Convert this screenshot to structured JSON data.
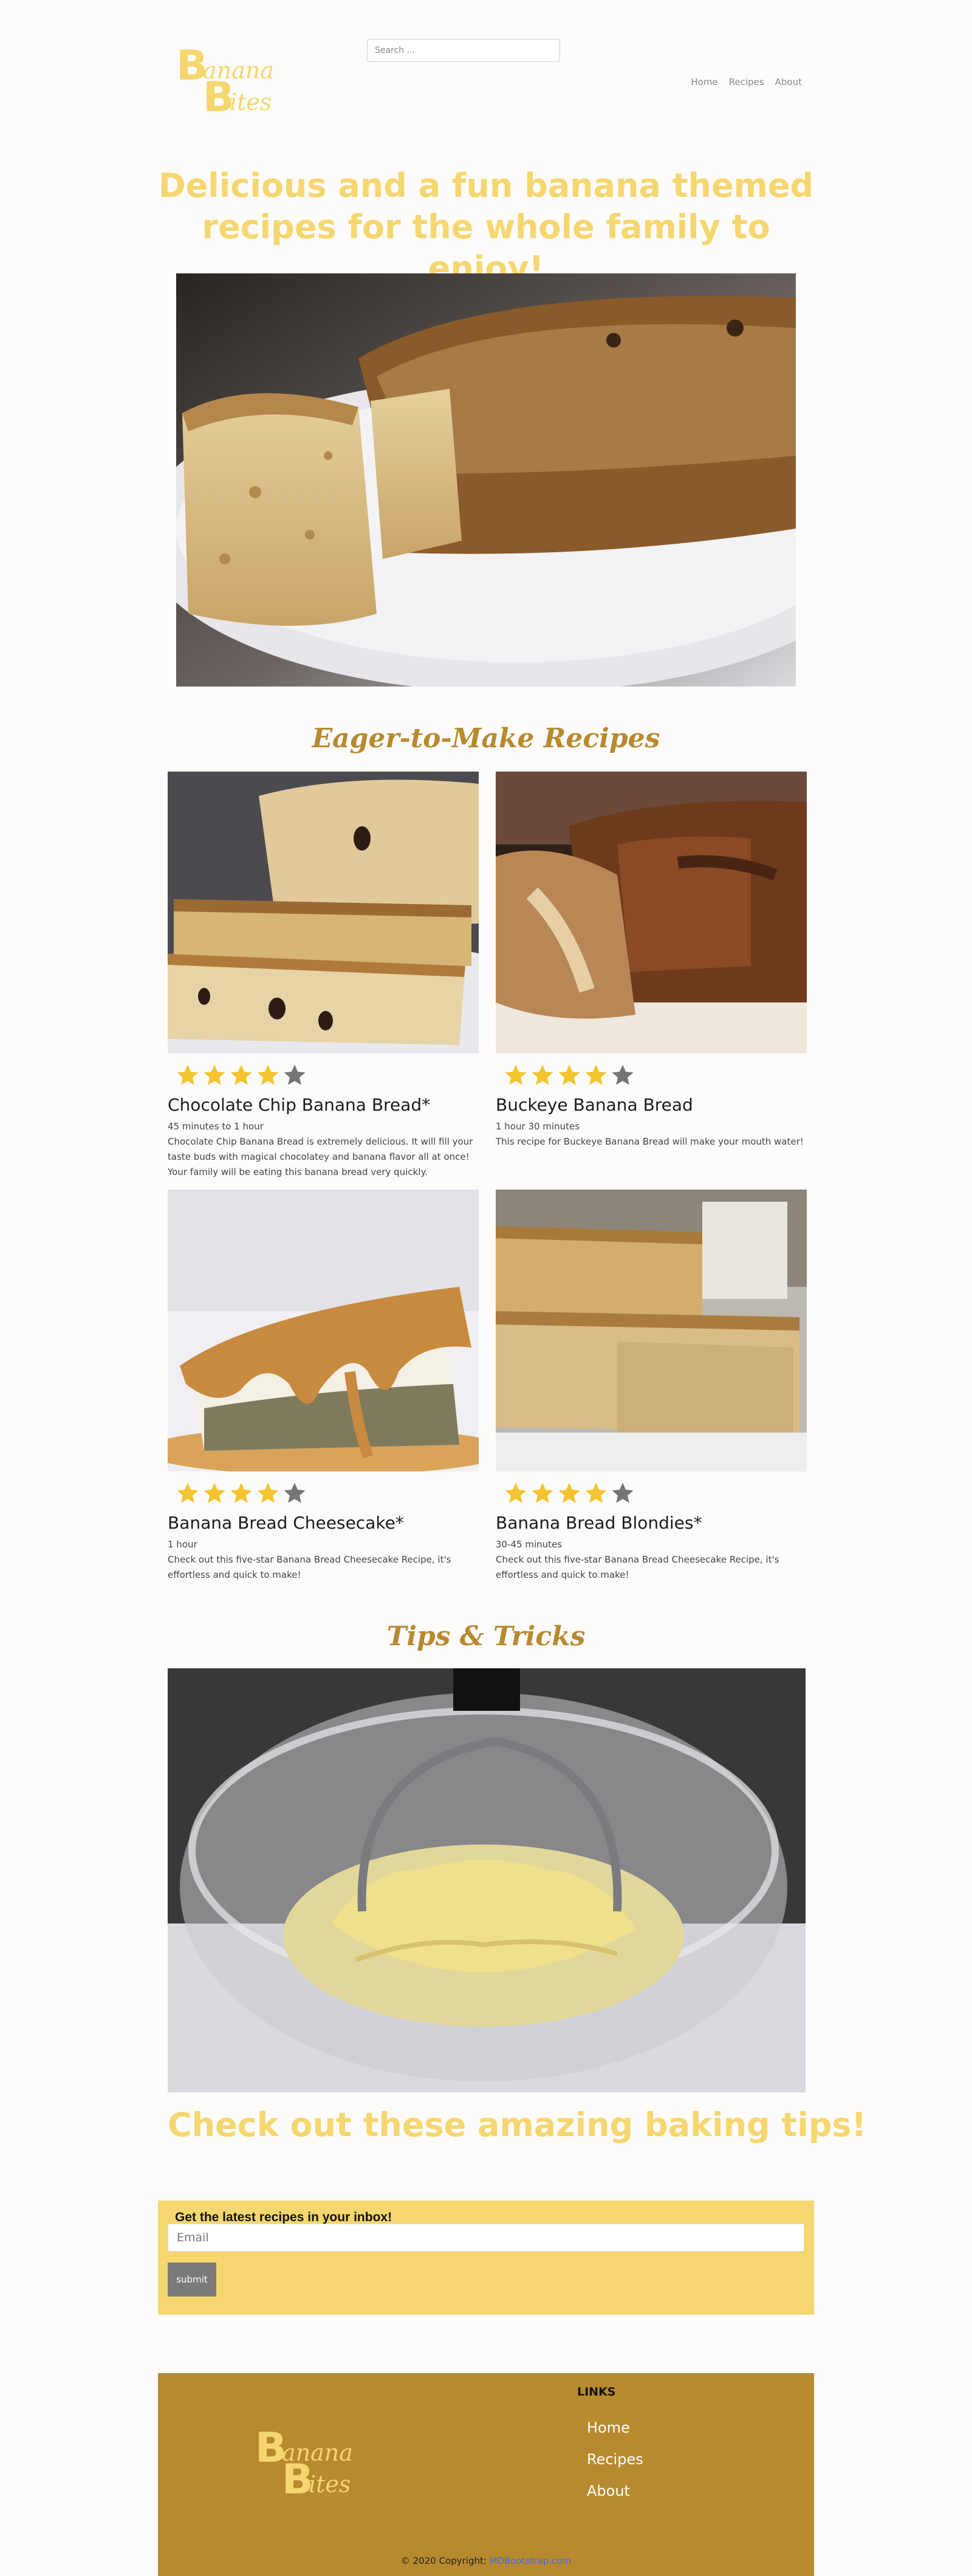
{
  "brand": {
    "line1_cap": "B",
    "line1_rest": "anana",
    "line2_cap": "B",
    "line2_rest": "ites",
    "color": "#f6d66f"
  },
  "header": {
    "search_placeholder": "Search ...",
    "nav": [
      "Home",
      "Recipes",
      "About"
    ]
  },
  "hero": {
    "title": "Delicious and a fun banana themed recipes for the whole family to enjoy!"
  },
  "recipes_section": {
    "heading": "Eager-to-Make Recipes",
    "cards": [
      {
        "title": "Chocolate Chip Banana Bread*",
        "time": "45 minutes to 1 hour",
        "description": "Chocolate Chip Banana Bread is extremely delicious. It will fill your taste buds with magical chocolatey and banana flavor all at once! Your family will be eating this banana bread very quickly.",
        "rating": 4,
        "max_rating": 5,
        "image": "chocolate-chip-banana-bread-photo"
      },
      {
        "title": "Buckeye Banana Bread",
        "time": "1 hour 30 minutes",
        "description": "This recipe for Buckeye Banana Bread will make your mouth water!",
        "rating": 4,
        "max_rating": 5,
        "image": "buckeye-banana-bread-photo"
      },
      {
        "title": "Banana Bread Cheesecake*",
        "time": "1 hour",
        "description": "Check out this five-star Banana Bread Cheesecake Recipe, it's effortless and quick to make!",
        "rating": 4,
        "max_rating": 5,
        "image": "banana-bread-cheesecake-photo"
      },
      {
        "title": "Banana Bread Blondies*",
        "time": "30-45 minutes",
        "description": "Check out this five-star Banana Bread Cheesecake Recipe, it's effortless and quick to make!",
        "rating": 4,
        "max_rating": 5,
        "image": "banana-bread-blondies-photo"
      }
    ]
  },
  "tips": {
    "heading": "Tips & Tricks",
    "title": "Check out these amazing baking tips!",
    "image": "mashing-bananas-photo"
  },
  "newsletter": {
    "title": "Get the latest recipes in your inbox!",
    "email_placeholder": "Email",
    "submit_label": "submit"
  },
  "footer": {
    "links_heading": "LINKS",
    "links": [
      "Home",
      "Recipes",
      "About"
    ],
    "copyright": "© 2020 Copyright:",
    "copyright_link": "MDBootstrap.com"
  },
  "colors": {
    "yellow": "#f6d66f",
    "gold": "#b88a2f",
    "star_filled": "#f4c430",
    "star_empty": "#757575"
  }
}
